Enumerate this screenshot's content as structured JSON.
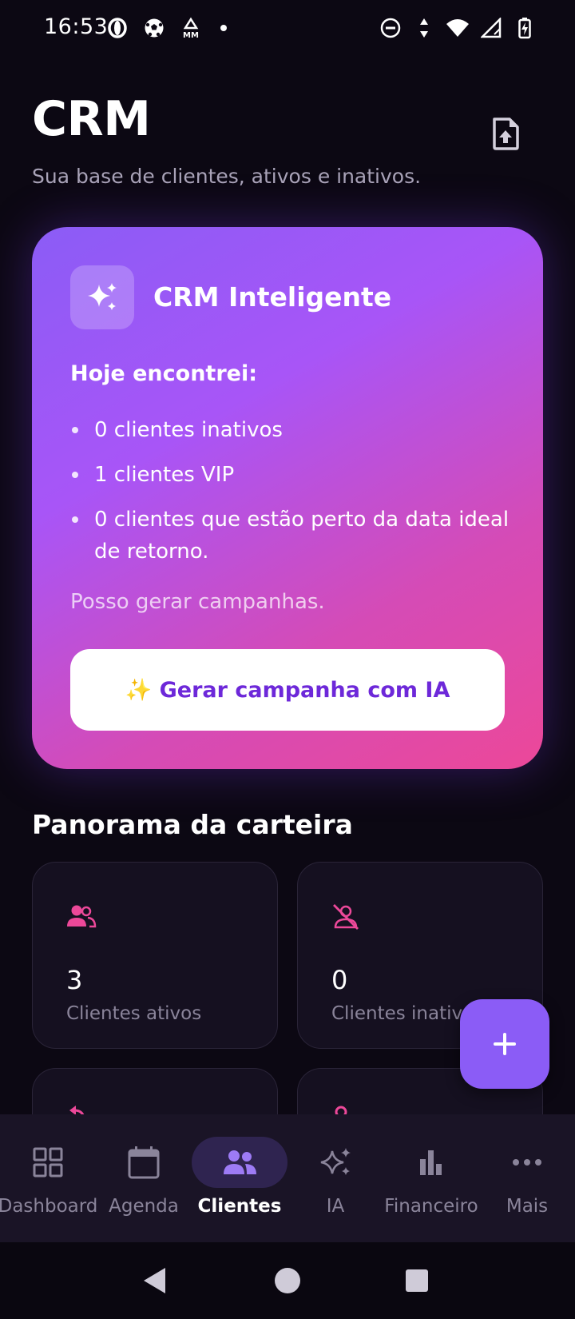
{
  "status_bar": {
    "time": "16:53",
    "left_icons": [
      "opera-icon",
      "soccer-ball-icon",
      "mm-alert-icon",
      "notification-dot"
    ],
    "right_icons": [
      "do-not-disturb-icon",
      "data-arrows-icon",
      "wifi-icon",
      "signal-icon",
      "battery-charging-icon"
    ]
  },
  "header": {
    "title": "CRM",
    "subtitle": "Sua base de clientes, ativos e inativos.",
    "export_icon": "file-upload-icon"
  },
  "ai_card": {
    "title": "CRM Inteligente",
    "icon": "sparkles-icon",
    "intro": "Hoje encontrei:",
    "items": [
      "0 clientes inativos",
      "1 clientes VIP",
      "0 clientes que estão perto da data ideal de retorno."
    ],
    "footer": "Posso gerar campanhas.",
    "button_label": "✨ Gerar campanha com IA",
    "colors": {
      "start": "#8b5cf6",
      "end": "#ec4899",
      "button_text": "#6d28d9"
    }
  },
  "portfolio": {
    "title": "Panorama da carteira",
    "stats": [
      {
        "icon": "users-icon",
        "value": "3",
        "label": "Clientes ativos"
      },
      {
        "icon": "user-off-icon",
        "value": "0",
        "label": "Clientes inativos"
      },
      {
        "icon": "reply-arrow-icon",
        "value": "",
        "label": ""
      },
      {
        "icon": "user-icon",
        "value": "",
        "label": ""
      }
    ],
    "accent_color": "#ec4899"
  },
  "fab": {
    "icon": "plus-icon",
    "color": "#8b5cf6"
  },
  "bottom_nav": {
    "items": [
      {
        "label": "Dashboard",
        "icon": "grid-icon",
        "active": false
      },
      {
        "label": "Agenda",
        "icon": "calendar-icon",
        "active": false
      },
      {
        "label": "Clientes",
        "icon": "users-icon",
        "active": true
      },
      {
        "label": "IA",
        "icon": "sparkles-icon",
        "active": false
      },
      {
        "label": "Financeiro",
        "icon": "bar-chart-icon",
        "active": false
      },
      {
        "label": "Mais",
        "icon": "more-horizontal-icon",
        "active": false
      }
    ]
  },
  "system_nav": {
    "buttons": [
      "back-icon",
      "home-icon",
      "recents-icon"
    ]
  }
}
